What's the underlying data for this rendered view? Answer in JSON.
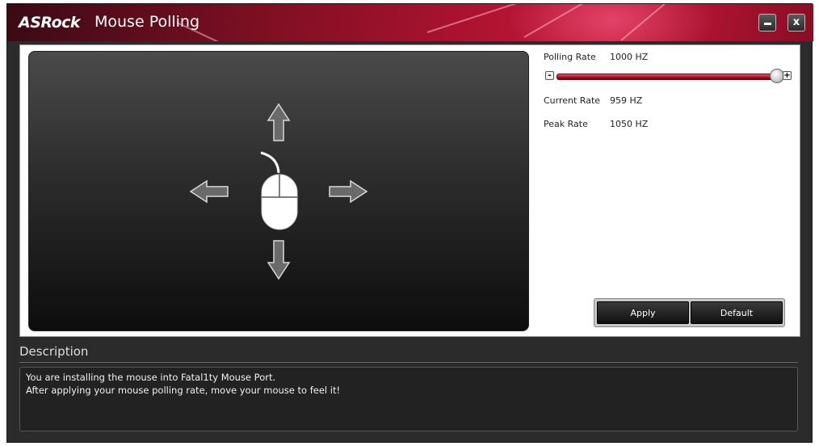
{
  "window": {
    "logo_text": "ASRock",
    "title": "Mouse Polling",
    "minimize_label": "",
    "close_label": "x"
  },
  "settings": {
    "polling_rate_label": "Polling Rate",
    "polling_rate_value": "1000 HZ",
    "slider": {
      "minus_label": "-",
      "plus_label": "+",
      "position_fraction": 1.0
    },
    "current_rate_label": "Current Rate",
    "current_rate_value": "959 HZ",
    "peak_rate_label": "Peak Rate",
    "peak_rate_value": "1050 HZ"
  },
  "actions": {
    "apply_label": "Apply",
    "default_label": "Default"
  },
  "description": {
    "title": "Description",
    "lines": [
      "You are installing the mouse into Fatal1ty Mouse Port.",
      "After applying your mouse polling rate, move your mouse to feel it!"
    ]
  },
  "colors": {
    "accent": "#a8122e",
    "preview_top": "#4a4a4a",
    "preview_bottom": "#0d0d0d"
  },
  "icons": {
    "mouse": "mouse-icon",
    "arrow_up": "arrow-up-icon",
    "arrow_down": "arrow-down-icon",
    "arrow_left": "arrow-left-icon",
    "arrow_right": "arrow-right-icon"
  }
}
